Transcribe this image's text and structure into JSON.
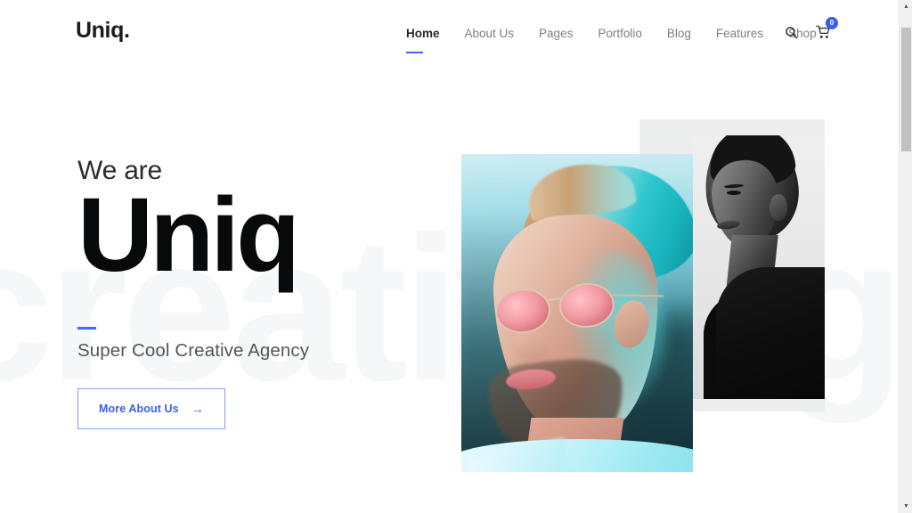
{
  "brand": {
    "name": "Uniq."
  },
  "nav": {
    "items": [
      {
        "label": "Home",
        "active": true
      },
      {
        "label": "About Us",
        "active": false
      },
      {
        "label": "Pages",
        "active": false
      },
      {
        "label": "Portfolio",
        "active": false
      },
      {
        "label": "Blog",
        "active": false
      },
      {
        "label": "Features",
        "active": false
      },
      {
        "label": "Shop",
        "active": false
      }
    ],
    "search_icon": "search-icon",
    "cart_icon": "shopping-cart-icon",
    "cart_count": "0"
  },
  "hero": {
    "kicker": "We are",
    "title": "Uniq",
    "subtitle": "Super Cool Creative Agency",
    "watermark": "creativeag",
    "cta": {
      "label": "More About Us",
      "arrow": "→"
    }
  },
  "media": {
    "photo_primary_alt": "man-with-pink-sunglasses-teal-portrait",
    "photo_secondary_alt": "black-and-white-male-portrait"
  },
  "colors": {
    "accent_blue": "#3a5ef5",
    "nav_link": "#7a7f87",
    "heading_dark": "#08090a",
    "watermark_gray": "#f6f7f8",
    "plate_gray": "#eceded"
  },
  "scrollbar": {
    "up_arrow": "▲",
    "down_arrow": "▼"
  }
}
